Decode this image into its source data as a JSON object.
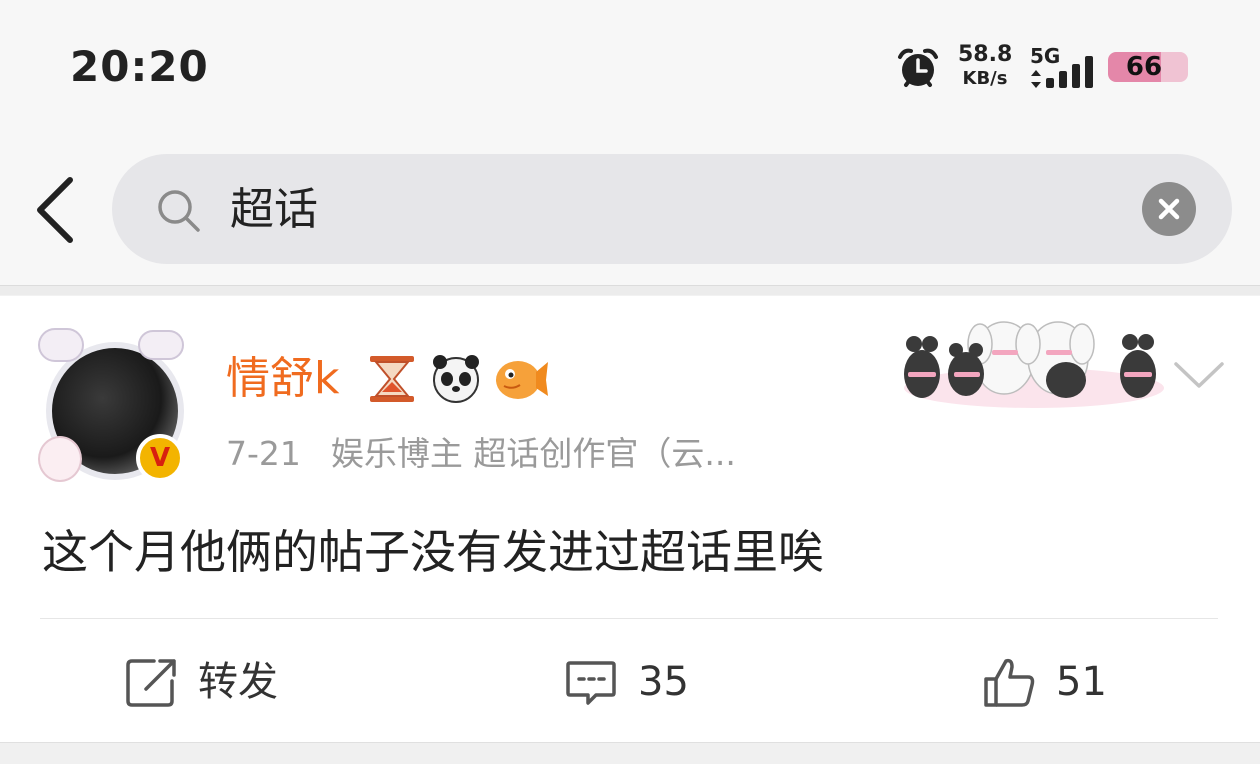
{
  "status_bar": {
    "time": "20:20",
    "net_speed_value": "58.8",
    "net_speed_unit": "KB/s",
    "network_type": "5G",
    "signal_level": 4,
    "battery_percent": "66",
    "icons": [
      "alarm-clock-icon",
      "signal-bars-icon",
      "battery-icon"
    ]
  },
  "search": {
    "query": "超话",
    "icons": [
      "back-arrow-icon",
      "search-icon",
      "clear-icon"
    ]
  },
  "post": {
    "username": "情舒k",
    "user_badges": [
      "hourglass-icon",
      "panda-icon",
      "fish-icon"
    ],
    "verified_badge": "V",
    "date": "7-21",
    "user_description": "娱乐博主 超话创作官（云...",
    "text": "这个月他俩的帖子没有发进过超话里唉",
    "colors": {
      "username": "#f06b1f",
      "verified_badge": "#f3b400"
    },
    "actions": {
      "repost_label": "转发",
      "comment_count": "35",
      "like_count": "51"
    }
  }
}
